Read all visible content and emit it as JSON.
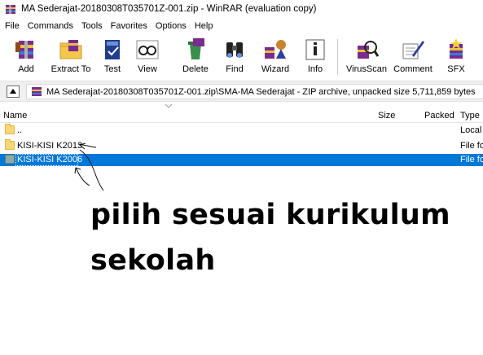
{
  "window": {
    "title": "MA Sederajat-20180308T035701Z-001.zip - WinRAR (evaluation copy)"
  },
  "menu": [
    "File",
    "Commands",
    "Tools",
    "Favorites",
    "Options",
    "Help"
  ],
  "toolbar": {
    "buttons": [
      {
        "label": "Add",
        "icon": "add-archive-icon"
      },
      {
        "label": "Extract To",
        "icon": "extract-folder-icon"
      },
      {
        "label": "Test",
        "icon": "test-book-icon"
      },
      {
        "label": "View",
        "icon": "view-glasses-icon"
      },
      {
        "label": "Delete",
        "icon": "delete-recycle-icon"
      },
      {
        "label": "Find",
        "icon": "find-binoculars-icon"
      },
      {
        "label": "Wizard",
        "icon": "wizard-icon"
      },
      {
        "label": "Info",
        "icon": "info-icon"
      },
      {
        "label": "VirusScan",
        "icon": "virusscan-icon"
      },
      {
        "label": "Comment",
        "icon": "comment-icon"
      },
      {
        "label": "SFX",
        "icon": "sfx-icon"
      }
    ]
  },
  "address": {
    "path": "MA Sederajat-20180308T035701Z-001.zip\\SMA-MA Sederajat - ZIP archive, unpacked size 5,711,859 bytes"
  },
  "columns": {
    "name": "Name",
    "size": "Size",
    "packed": "Packed",
    "type": "Type"
  },
  "files": [
    {
      "name": "..",
      "type": "Local",
      "selected": false
    },
    {
      "name": "KISI-KISI K2013",
      "type": "File fo",
      "selected": false
    },
    {
      "name": "KISI-KISI K2006",
      "type": "File fo",
      "selected": true
    }
  ],
  "annotation": {
    "line1": "pilih sesuai kurikulum",
    "line2": "sekolah"
  },
  "colors": {
    "selection": "#0078d7",
    "folder": "#f8d775"
  }
}
